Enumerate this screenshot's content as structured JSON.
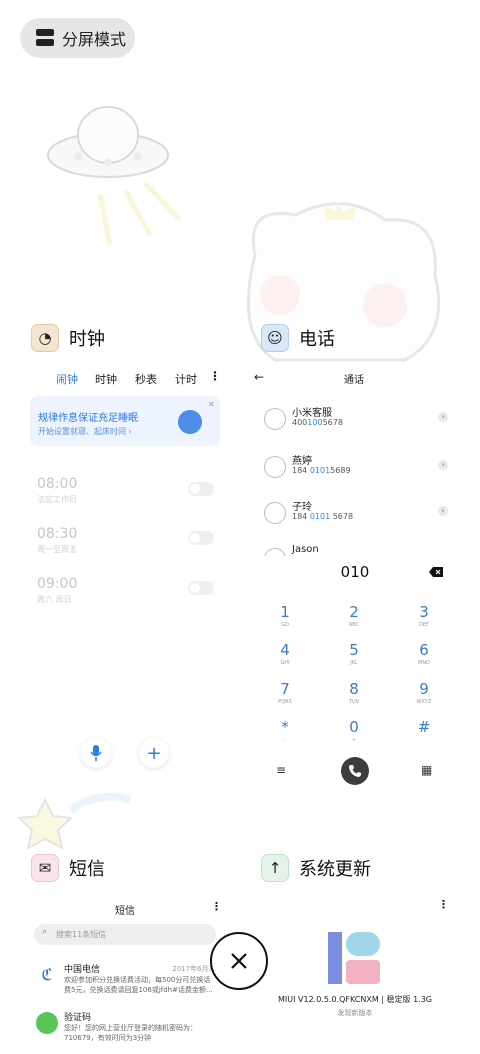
{
  "split_mode": {
    "label": "分屏模式"
  },
  "apps": {
    "clock": {
      "title": "时钟",
      "tabs": [
        "闹钟",
        "时钟",
        "秒表",
        "计时"
      ],
      "active_tab": "闹钟",
      "more_icon": "more-vertical-icon",
      "banner": {
        "title": "规律作息保证充足睡眠",
        "subtitle": "开始设置就寝、起床时间 ›"
      },
      "alarms": [
        {
          "time": "08:00",
          "repeat": "法定工作日"
        },
        {
          "time": "08:30",
          "repeat": "周一至周五"
        },
        {
          "time": "09:00",
          "repeat": "周六 周日"
        }
      ]
    },
    "phone": {
      "title": "电话",
      "header": "通话",
      "contacts": [
        {
          "name": "小米客服",
          "number_pre": "400",
          "number_hl": "100",
          "number_post": "5678"
        },
        {
          "name": "燕婷",
          "number_pre": "184 ",
          "number_hl": "0101",
          "number_post": "5689"
        },
        {
          "name": "子玲",
          "number_pre": "184 ",
          "number_hl": "0101",
          "number_post": " 5678"
        },
        {
          "name": "Jason",
          "number_pre": "",
          "number_hl": "",
          "number_post": ""
        }
      ],
      "dial_input": "010",
      "keys": [
        {
          "d": "1",
          "l": "GD"
        },
        {
          "d": "2",
          "l": "ABC"
        },
        {
          "d": "3",
          "l": "DEF"
        },
        {
          "d": "4",
          "l": "GHI"
        },
        {
          "d": "5",
          "l": "JKL"
        },
        {
          "d": "6",
          "l": "MNO"
        },
        {
          "d": "7",
          "l": "PQRS"
        },
        {
          "d": "8",
          "l": "TUV"
        },
        {
          "d": "9",
          "l": "WXYZ"
        },
        {
          "d": "*",
          "l": ","
        },
        {
          "d": "0",
          "l": "+"
        },
        {
          "d": "#",
          "l": ""
        }
      ]
    },
    "sms": {
      "title": "短信",
      "header": "短信",
      "search_placeholder": "搜索11条短信",
      "messages": [
        {
          "name": "中国电信",
          "time": "2017年6月3",
          "body": "欢迎参加积分兑换话费活动，每500分可兑换话费5元，兑换话费请回复106或jfdh#话费金额..."
        },
        {
          "name": "验证码",
          "time": "",
          "body": "您好！您的网上营业厅登录的随机密码为：710679，有效时间为3分钟"
        }
      ]
    },
    "update": {
      "title": "系统更新",
      "version": "MIUI V12.0.5.0.QFKCNXM | 稳定版 1.3G",
      "sub": "发现新版本"
    }
  },
  "close_icon": "close-icon",
  "colors": {
    "accent": "#2d7be5",
    "phone_blue": "#3a7ebf"
  }
}
